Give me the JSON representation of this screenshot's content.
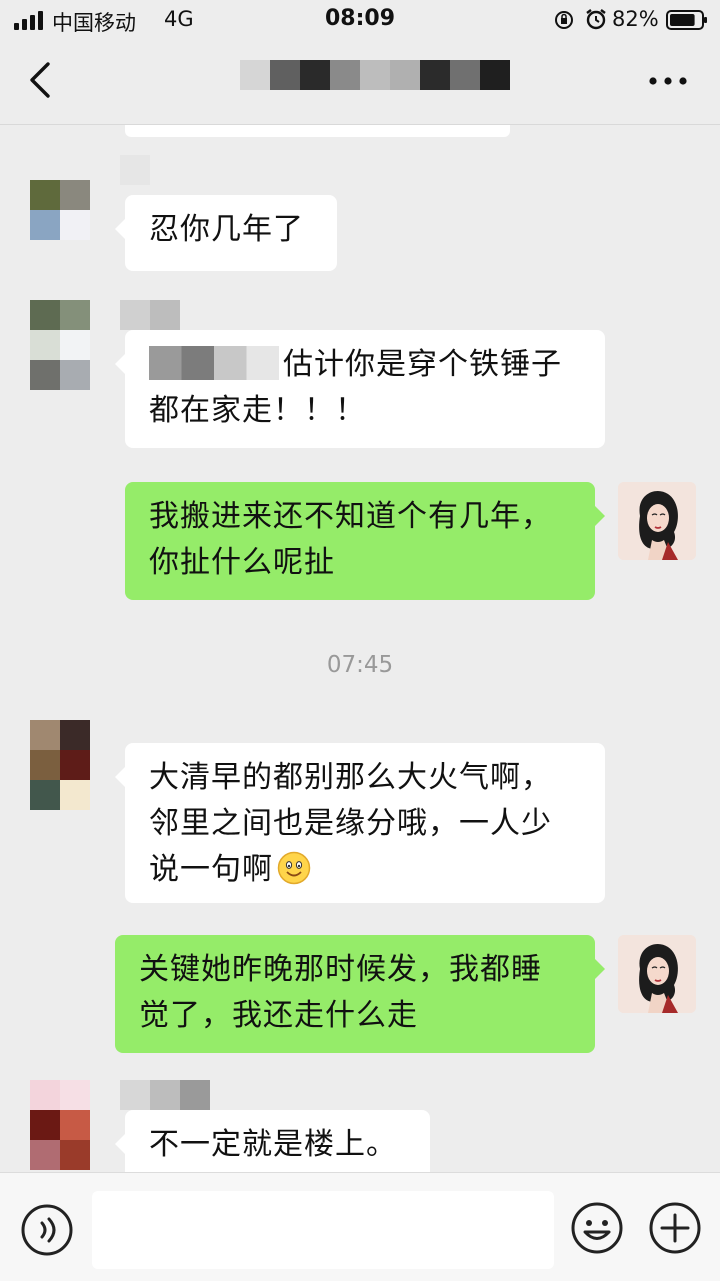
{
  "status_bar": {
    "carrier": "中国移动",
    "network": "4G",
    "time": "08:09",
    "battery_percent": "82%",
    "battery_level": 0.82,
    "icons": [
      "signal-icon",
      "rotation-lock-icon",
      "alarm-icon",
      "battery-icon"
    ]
  },
  "nav": {
    "back_icon": "chevron-left-icon",
    "more_icon": "more-dots-icon"
  },
  "messages": [
    {
      "side": "in",
      "text": "忍你几年了"
    },
    {
      "side": "in",
      "text": "估计你是穿个铁锤子都在家走！！！"
    },
    {
      "side": "out",
      "text": "我搬进来还不知道个有几年，你扯什么呢扯"
    },
    {
      "side": "in",
      "text": "大清早的都别那么大火气啊，邻里之间也是缘分哦，一人少说一句啊",
      "emoji": "smiling-face-icon"
    },
    {
      "side": "out",
      "text": "关键她昨晚那时候发，我都睡觉了，我还走什么走"
    },
    {
      "side": "in",
      "text": "不一定就是楼上。"
    }
  ],
  "timestamp": "07:45",
  "input_bar": {
    "voice_icon": "voice-icon",
    "emoji_icon": "emoji-icon",
    "plus_icon": "plus-icon"
  }
}
